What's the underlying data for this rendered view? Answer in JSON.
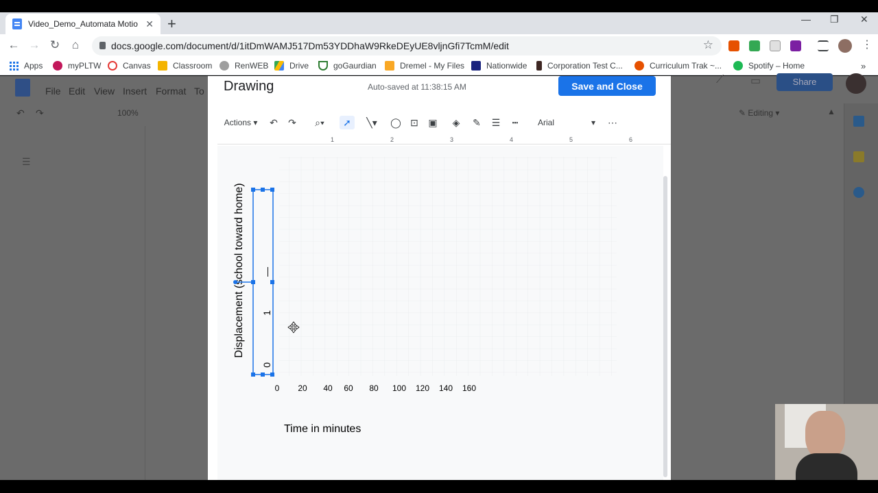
{
  "browser": {
    "tab_title": "Video_Demo_Automata MotionC",
    "url": "docs.google.com/document/d/1itDmWAMJ517Dm53YDDhaW9RkeDEyUE8vljnGfi7TcmM/edit",
    "bookmarks": [
      {
        "label": "Apps"
      },
      {
        "label": "myPLTW"
      },
      {
        "label": "Canvas"
      },
      {
        "label": "Classroom"
      },
      {
        "label": "RenWEB"
      },
      {
        "label": "Drive"
      },
      {
        "label": "goGaurdian"
      },
      {
        "label": "Dremel - My Files"
      },
      {
        "label": "Nationwide"
      },
      {
        "label": "Corporation Test C..."
      },
      {
        "label": "Curriculum Trak ~..."
      },
      {
        "label": "Spotify – Home"
      }
    ],
    "bookmark_icon_colors": [
      "#1a73e8",
      "#c2185b",
      "#e53935",
      "#f4b400",
      "#9e9e9e",
      "#34a853",
      "#2e7d32",
      "#f9a825",
      "#1a237e",
      "#3e2723",
      "#e65100",
      "#1db954"
    ]
  },
  "docs": {
    "menu": [
      "File",
      "Edit",
      "View",
      "Insert",
      "Format",
      "To"
    ],
    "zoom": "100%",
    "mode": "Editing",
    "share_label": "Share"
  },
  "drawing": {
    "title": "Drawing",
    "autosave": "Auto-saved at 11:38:15 AM",
    "save_close": "Save and Close",
    "actions_label": "Actions",
    "font": "Arial",
    "ruler_marks": [
      "1",
      "2",
      "3",
      "4",
      "5",
      "6"
    ],
    "y_axis_label": "Displacement  (school toward home)",
    "y_ticks": [
      "0",
      "1",
      "—"
    ],
    "x_ticks": [
      "0",
      "20",
      "40",
      "60",
      "80",
      "100",
      "120",
      "140",
      "160"
    ],
    "x_axis_label": "Time in minutes"
  },
  "colors": {
    "accent": "#1a73e8",
    "selection": "#1a73e8"
  }
}
